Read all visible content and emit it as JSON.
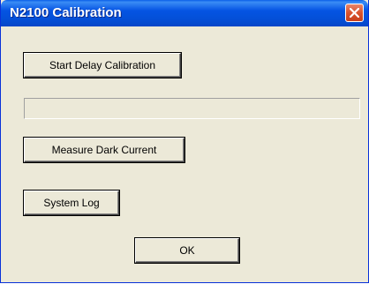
{
  "window": {
    "title": "N2100 Calibration"
  },
  "buttons": {
    "start_delay_calibration": "Start Delay Calibration",
    "measure_dark_current": "Measure Dark Current",
    "system_log": "System Log",
    "ok": "OK"
  },
  "progress": {
    "value": 0
  },
  "icons": {
    "close": "close-icon"
  },
  "colors": {
    "titlebar": "#0554e3",
    "close_button": "#d9532e",
    "dialog_background": "#ece9d8"
  }
}
